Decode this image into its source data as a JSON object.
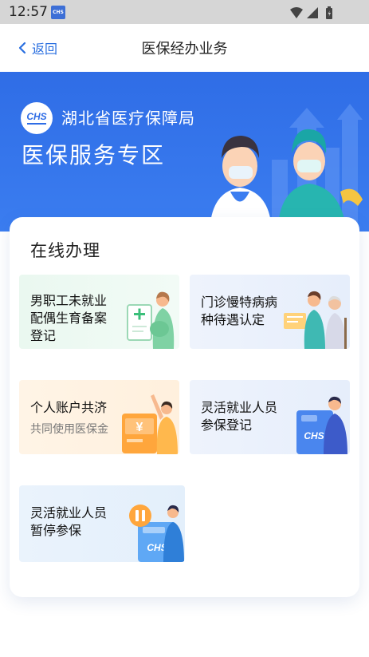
{
  "status_bar": {
    "time": "12:57",
    "app_icon_text": "CHS"
  },
  "header": {
    "back_label": "返回",
    "title": "医保经办业务"
  },
  "banner": {
    "logo_text": "CHS",
    "bureau_name": "湖北省医疗保障局",
    "zone_title": "医保服务专区"
  },
  "section": {
    "title": "在线办理",
    "tiles": [
      {
        "lines": [
          "男职工未就业",
          "配偶生育备案",
          "登记"
        ]
      },
      {
        "lines": [
          "门诊慢特病病",
          "种待遇认定"
        ]
      },
      {
        "lines": [
          "个人账户共济"
        ],
        "sub": "共同使用医保金"
      },
      {
        "lines": [
          "灵活就业人员",
          "参保登记"
        ]
      },
      {
        "lines": [
          "灵活就业人员",
          "暂停参保"
        ]
      }
    ]
  },
  "colors": {
    "brand_blue": "#2f6de6",
    "link_blue": "#2a6fe0"
  }
}
